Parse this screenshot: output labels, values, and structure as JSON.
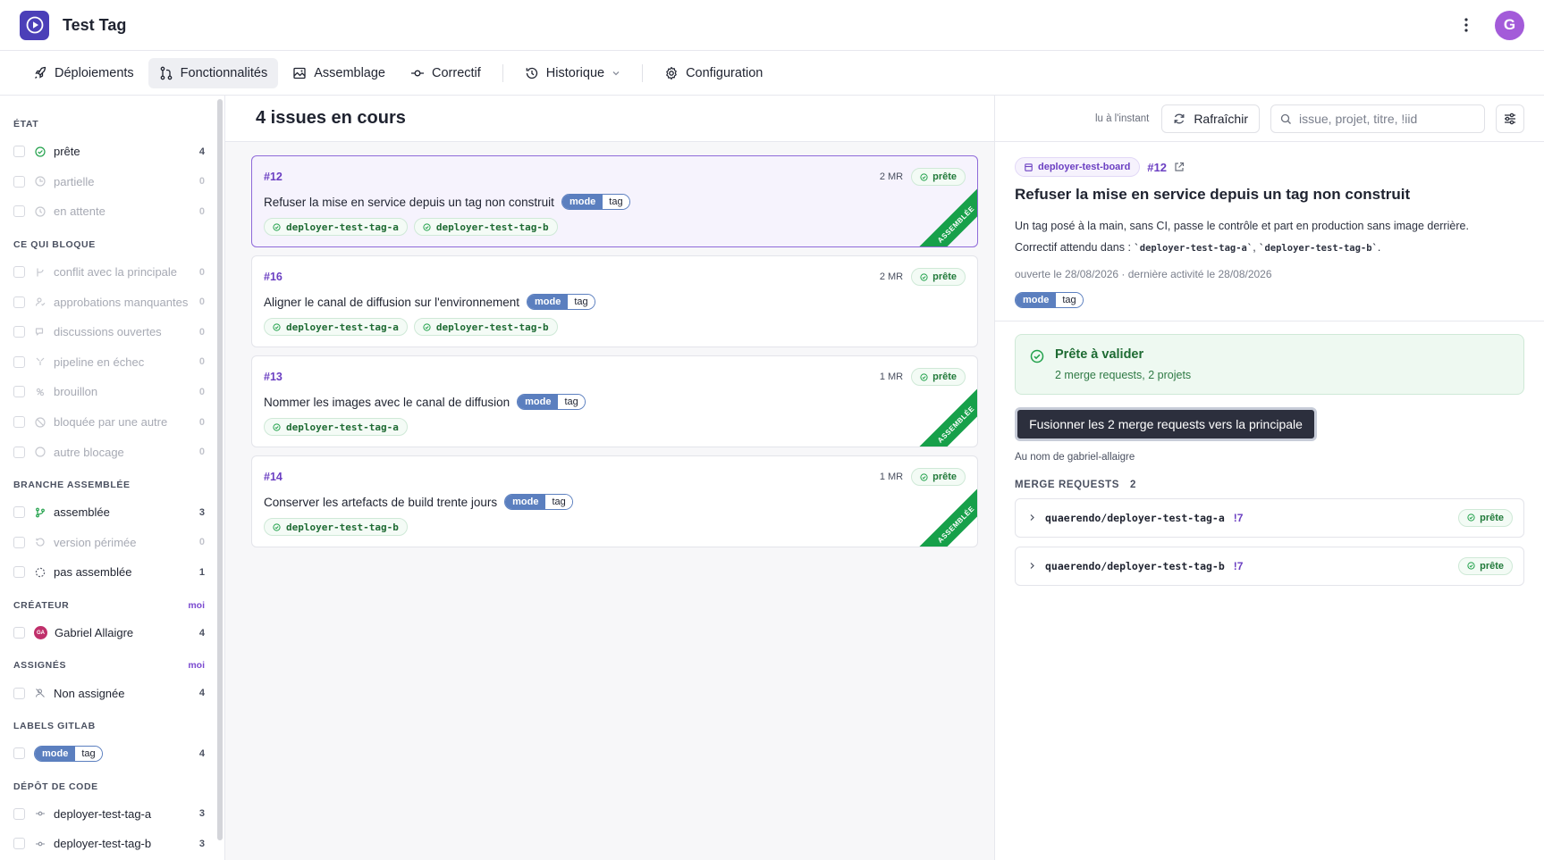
{
  "app": {
    "title": "Test Tag",
    "avatar_letter": "G"
  },
  "tabs": [
    {
      "label": "Déploiements",
      "icon": "rocket-icon",
      "active": false
    },
    {
      "label": "Fonctionnalités",
      "icon": "merge-icon",
      "active": true
    },
    {
      "label": "Assemblage",
      "icon": "image-icon",
      "active": false
    },
    {
      "label": "Correctif",
      "icon": "commit-icon",
      "active": false
    },
    {
      "label": "Historique",
      "icon": "history-icon",
      "active": false
    },
    {
      "label": "Configuration",
      "icon": "gear-icon",
      "active": false
    }
  ],
  "sidebar": {
    "etat": {
      "title": "ÉTAT",
      "items": [
        {
          "label": "prête",
          "count": "4",
          "icon": "check-circle-icon",
          "dim": false
        },
        {
          "label": "partielle",
          "count": "0",
          "icon": "circle-icon",
          "dim": true
        },
        {
          "label": "en attente",
          "count": "0",
          "icon": "clock-icon",
          "dim": true
        }
      ]
    },
    "bloque": {
      "title": "CE QUI BLOQUE",
      "items": [
        {
          "label": "conflit avec la principale",
          "count": "0",
          "icon": "conflict-icon",
          "dim": true
        },
        {
          "label": "approbations manquantes",
          "count": "0",
          "icon": "user-check-icon",
          "dim": true
        },
        {
          "label": "discussions ouvertes",
          "count": "0",
          "icon": "chat-icon",
          "dim": true
        },
        {
          "label": "pipeline en échec",
          "count": "0",
          "icon": "pipeline-icon",
          "dim": true
        },
        {
          "label": "brouillon",
          "count": "0",
          "icon": "draft-icon",
          "dim": true
        },
        {
          "label": "bloquée par une autre",
          "count": "0",
          "icon": "blocked-icon",
          "dim": true
        },
        {
          "label": "autre blocage",
          "count": "0",
          "icon": "circle-icon",
          "dim": true
        }
      ]
    },
    "branche": {
      "title": "BRANCHE ASSEMBLÉE",
      "items": [
        {
          "label": "assemblée",
          "count": "3",
          "icon": "branch-icon",
          "dim": false
        },
        {
          "label": "version périmée",
          "count": "0",
          "icon": "history-icon",
          "dim": true
        },
        {
          "label": "pas assemblée",
          "count": "1",
          "icon": "dashed-circle-icon",
          "dim": false
        }
      ]
    },
    "createur": {
      "title": "CRÉATEUR",
      "moi": "moi",
      "items": [
        {
          "label": "Gabriel Allaigre",
          "count": "4",
          "initials": "GA"
        }
      ]
    },
    "assignes": {
      "title": "ASSIGNÉS",
      "moi": "moi",
      "items": [
        {
          "label": "Non assignée",
          "count": "4",
          "icon": "unassigned-icon"
        }
      ]
    },
    "labels": {
      "title": "LABELS GITLAB",
      "items": [
        {
          "scope": "mode",
          "value": "tag",
          "count": "4"
        }
      ]
    },
    "depot": {
      "title": "DÉPÔT DE CODE",
      "items": [
        {
          "label": "deployer-test-tag-a",
          "count": "3",
          "icon": "repo-icon"
        },
        {
          "label": "deployer-test-tag-b",
          "count": "3",
          "icon": "repo-icon"
        }
      ]
    }
  },
  "center": {
    "title": "4 issues en cours",
    "cards": [
      {
        "num": "#12",
        "mr": "2 MR",
        "status": "prête",
        "title": "Refuser la mise en service depuis un tag non construit",
        "label_scope": "mode",
        "label_value": "tag",
        "repos": [
          "deployer-test-tag-a",
          "deployer-test-tag-b"
        ],
        "ribbon": "ASSEMBLÉE",
        "selected": true
      },
      {
        "num": "#16",
        "mr": "2 MR",
        "status": "prête",
        "title": "Aligner le canal de diffusion sur l'environnement",
        "label_scope": "mode",
        "label_value": "tag",
        "repos": [
          "deployer-test-tag-a",
          "deployer-test-tag-b"
        ],
        "ribbon": "",
        "selected": false
      },
      {
        "num": "#13",
        "mr": "1 MR",
        "status": "prête",
        "title": "Nommer les images avec le canal de diffusion",
        "label_scope": "mode",
        "label_value": "tag",
        "repos": [
          "deployer-test-tag-a"
        ],
        "ribbon": "ASSEMBLÉE",
        "selected": false
      },
      {
        "num": "#14",
        "mr": "1 MR",
        "status": "prête",
        "title": "Conserver les artefacts de build trente jours",
        "label_scope": "mode",
        "label_value": "tag",
        "repos": [
          "deployer-test-tag-b"
        ],
        "ribbon": "ASSEMBLÉE",
        "selected": false
      }
    ]
  },
  "toolbar": {
    "refresh_meta": "lu à l'instant",
    "refresh_label": "Rafraîchir",
    "search_placeholder": "issue, projet, titre, !iid"
  },
  "detail": {
    "board": "deployer-test-board",
    "num": "#12",
    "title": "Refuser la mise en service depuis un tag non construit",
    "desc1": "Un tag posé à la main, sans CI, passe le contrôle et part en production sans image derrière.",
    "desc2_prefix": "Correctif attendu dans :",
    "desc2_code_a": "`deployer-test-tag-a`",
    "desc2_code_b": "`deployer-test-tag-b`",
    "dates": "ouverte le 28/08/2026 · dernière activité le 28/08/2026",
    "label_scope": "mode",
    "label_value": "tag",
    "ready_title": "Prête à valider",
    "ready_sub": "2 merge requests, 2 projets",
    "merge_button": "Fusionner les 2 merge requests vers la principale",
    "on_behalf": "Au nom de gabriel-allaigre",
    "mr_heading": "MERGE REQUESTS",
    "mr_count": "2",
    "merge_requests": [
      {
        "name": "quaerendo/deployer-test-tag-a",
        "iid": "!7",
        "status": "prête"
      },
      {
        "name": "quaerendo/deployer-test-tag-b",
        "iid": "!7",
        "status": "prête"
      }
    ]
  },
  "colors": {
    "accent": "#6b3fc2",
    "ready_green": "#17a04a",
    "label_blue": "#5b7fbf",
    "merge_button": "#2c2f3d"
  }
}
